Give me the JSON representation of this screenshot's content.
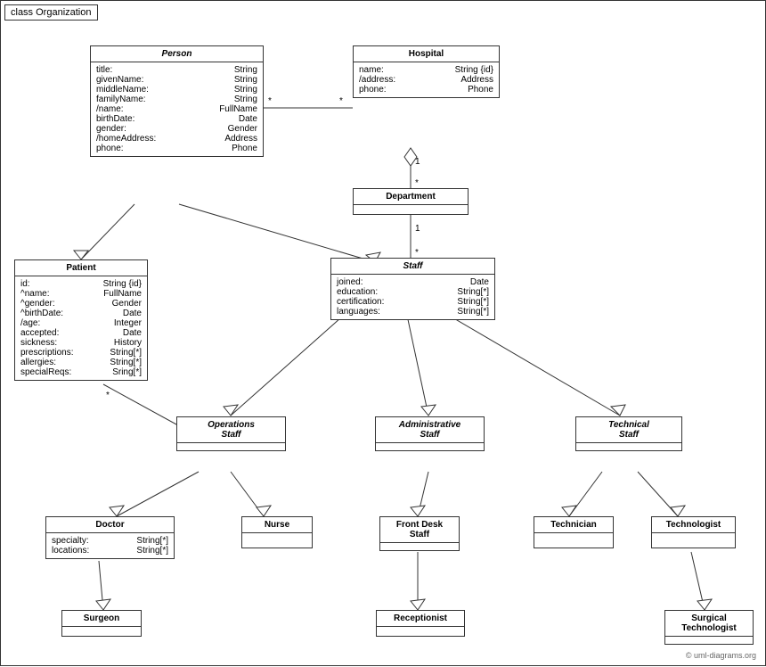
{
  "diagram": {
    "title": "class Organization",
    "copyright": "© uml-diagrams.org",
    "classes": {
      "person": {
        "name": "Person",
        "italic": true,
        "attrs": [
          [
            "title:",
            "String"
          ],
          [
            "givenName:",
            "String"
          ],
          [
            "middleName:",
            "String"
          ],
          [
            "familyName:",
            "String"
          ],
          [
            "/name:",
            "FullName"
          ],
          [
            "birthDate:",
            "Date"
          ],
          [
            "gender:",
            "Gender"
          ],
          [
            "/homeAddress:",
            "Address"
          ],
          [
            "phone:",
            "Phone"
          ]
        ]
      },
      "hospital": {
        "name": "Hospital",
        "italic": false,
        "attrs": [
          [
            "name:",
            "String {id}"
          ],
          [
            "/address:",
            "Address"
          ],
          [
            "phone:",
            "Phone"
          ]
        ]
      },
      "department": {
        "name": "Department",
        "italic": false,
        "attrs": []
      },
      "staff": {
        "name": "Staff",
        "italic": true,
        "attrs": [
          [
            "joined:",
            "Date"
          ],
          [
            "education:",
            "String[*]"
          ],
          [
            "certification:",
            "String[*]"
          ],
          [
            "languages:",
            "String[*]"
          ]
        ]
      },
      "patient": {
        "name": "Patient",
        "italic": false,
        "attrs": [
          [
            "id:",
            "String {id}"
          ],
          [
            "^name:",
            "FullName"
          ],
          [
            "^gender:",
            "Gender"
          ],
          [
            "^birthDate:",
            "Date"
          ],
          [
            "/age:",
            "Integer"
          ],
          [
            "accepted:",
            "Date"
          ],
          [
            "sickness:",
            "History"
          ],
          [
            "prescriptions:",
            "String[*]"
          ],
          [
            "allergies:",
            "String[*]"
          ],
          [
            "specialReqs:",
            "Sring[*]"
          ]
        ]
      },
      "operationsStaff": {
        "name": "Operations\nStaff",
        "italic": true,
        "attrs": []
      },
      "administrativeStaff": {
        "name": "Administrative\nStaff",
        "italic": true,
        "attrs": []
      },
      "technicalStaff": {
        "name": "Technical\nStaff",
        "italic": true,
        "attrs": []
      },
      "doctor": {
        "name": "Doctor",
        "italic": false,
        "attrs": [
          [
            "specialty:",
            "String[*]"
          ],
          [
            "locations:",
            "String[*]"
          ]
        ]
      },
      "nurse": {
        "name": "Nurse",
        "italic": false,
        "attrs": []
      },
      "frontDeskStaff": {
        "name": "Front Desk\nStaff",
        "italic": false,
        "attrs": []
      },
      "technician": {
        "name": "Technician",
        "italic": false,
        "attrs": []
      },
      "technologist": {
        "name": "Technologist",
        "italic": false,
        "attrs": []
      },
      "surgeon": {
        "name": "Surgeon",
        "italic": false,
        "attrs": []
      },
      "receptionist": {
        "name": "Receptionist",
        "italic": false,
        "attrs": []
      },
      "surgicalTechnologist": {
        "name": "Surgical\nTechnologist",
        "italic": false,
        "attrs": []
      }
    }
  }
}
